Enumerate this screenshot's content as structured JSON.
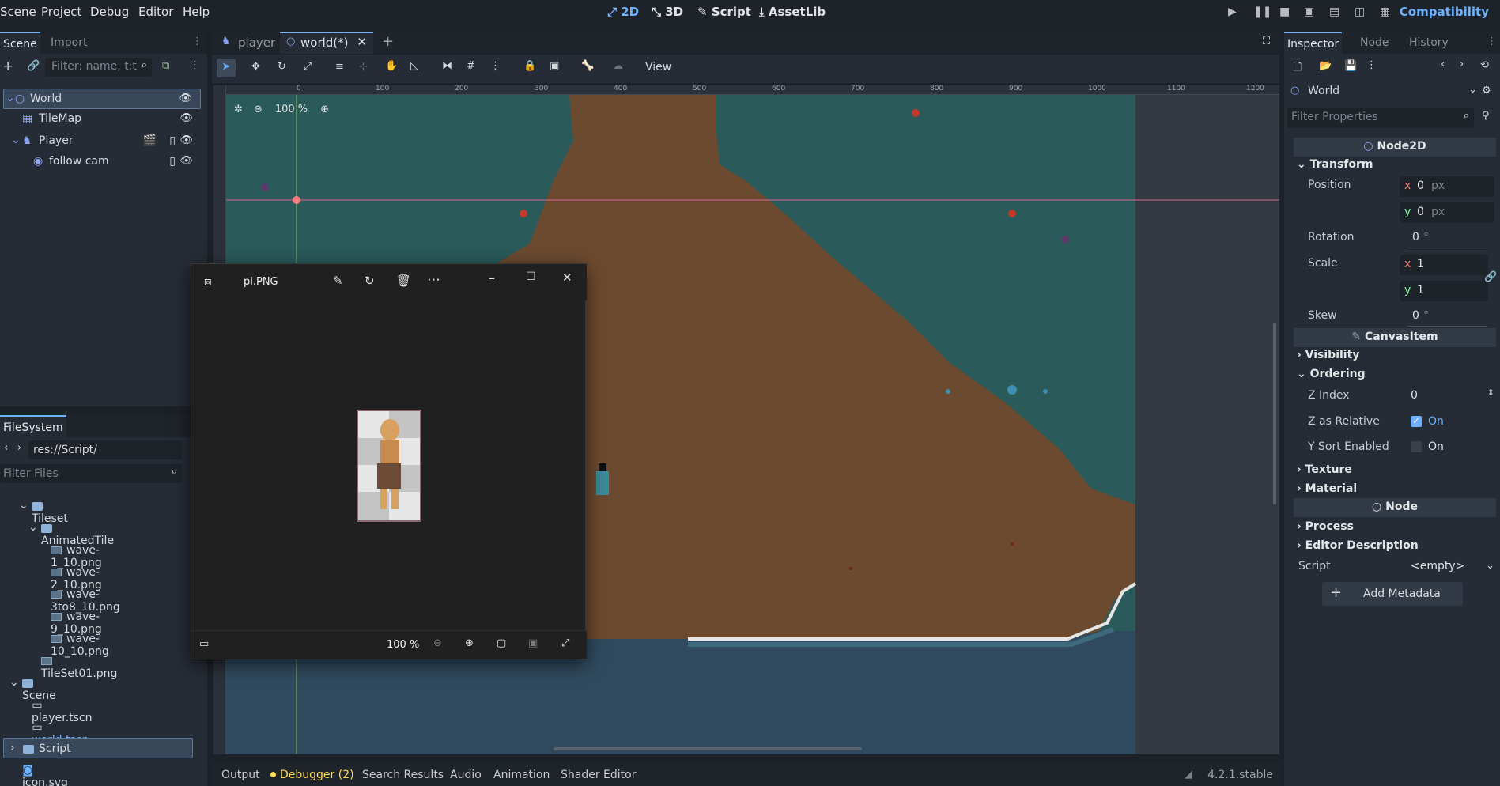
{
  "menu": {
    "items": [
      "Scene",
      "Project",
      "Debug",
      "Editor",
      "Help"
    ],
    "workspaces": [
      "2D",
      "3D",
      "Script",
      "AssetLib"
    ],
    "active_workspace": "2D",
    "renderer": "Compatibility"
  },
  "scene_dock": {
    "tabs": [
      "Scene",
      "Import"
    ],
    "filter_placeholder": "Filter: name, t:t",
    "tree": [
      {
        "label": "World",
        "icon": "node2d-icon",
        "selected": true
      },
      {
        "label": "TileMap",
        "icon": "tilemap-icon"
      },
      {
        "label": "Player",
        "icon": "characterbody-icon"
      },
      {
        "label": "follow cam",
        "icon": "camera-icon"
      }
    ]
  },
  "filesystem": {
    "tab": "FileSystem",
    "path": "res://Script/",
    "filter_placeholder": "Filter Files",
    "items": [
      {
        "label": "Tileset",
        "type": "folder",
        "level": 1
      },
      {
        "label": "AnimatedTile",
        "type": "folder",
        "level": 2
      },
      {
        "label": "wave-1_10.png",
        "type": "image",
        "level": 3
      },
      {
        "label": "wave-2_10.png",
        "type": "image",
        "level": 3
      },
      {
        "label": "wave-3to8_10.png",
        "type": "image",
        "level": 3
      },
      {
        "label": "wave-9_10.png",
        "type": "image",
        "level": 3
      },
      {
        "label": "wave-10_10.png",
        "type": "image",
        "level": 3
      },
      {
        "label": "TileSet01.png",
        "type": "image",
        "level": 2
      },
      {
        "label": "Scene",
        "type": "folder",
        "level": 1
      },
      {
        "label": "player.tscn",
        "type": "scene",
        "level": 2
      },
      {
        "label": "world.tscn",
        "type": "scene",
        "level": 2
      },
      {
        "label": "Script",
        "type": "folder",
        "level": 1,
        "selected": true
      },
      {
        "label": "icon.svg",
        "type": "svg",
        "level": 1
      }
    ]
  },
  "editor": {
    "tabs": [
      {
        "label": "player",
        "active": false
      },
      {
        "label": "world(*)",
        "active": true
      }
    ],
    "toolbar_view": "View",
    "zoom": "100 %",
    "ruler": [
      "0",
      "100",
      "200",
      "300",
      "400",
      "500",
      "600",
      "700",
      "800",
      "900",
      "1000",
      "1100",
      "1200"
    ]
  },
  "photo_viewer": {
    "filename": "pl.PNG",
    "zoom": "100 %"
  },
  "bottom_panel": {
    "tabs": [
      "Output",
      "Debugger (2)",
      "Search Results",
      "Audio",
      "Animation",
      "Shader Editor"
    ],
    "version": "4.2.1.stable"
  },
  "inspector": {
    "tabs": [
      "Inspector",
      "Node",
      "History"
    ],
    "node_name": "World",
    "filter_placeholder": "Filter Properties",
    "class_header": "Node2D",
    "transform": {
      "title": "Transform",
      "position_label": "Position",
      "position_x": "0",
      "position_y": "0",
      "unit": "px",
      "rotation_label": "Rotation",
      "rotation": "0",
      "rotation_unit": "°",
      "scale_label": "Scale",
      "scale_x": "1",
      "scale_y": "1",
      "skew_label": "Skew",
      "skew": "0",
      "skew_unit": "°"
    },
    "canvas_item_header": "CanvasItem",
    "visibility": "Visibility",
    "ordering": "Ordering",
    "z_index_label": "Z Index",
    "z_index": "0",
    "z_relative_label": "Z as Relative",
    "z_relative": "On",
    "y_sort_label": "Y Sort Enabled",
    "y_sort": "On",
    "texture": "Texture",
    "material": "Material",
    "node_header": "Node",
    "process": "Process",
    "editor_description": "Editor Description",
    "script_label": "Script",
    "script_value": "<empty>",
    "add_metadata": "Add Metadata"
  }
}
